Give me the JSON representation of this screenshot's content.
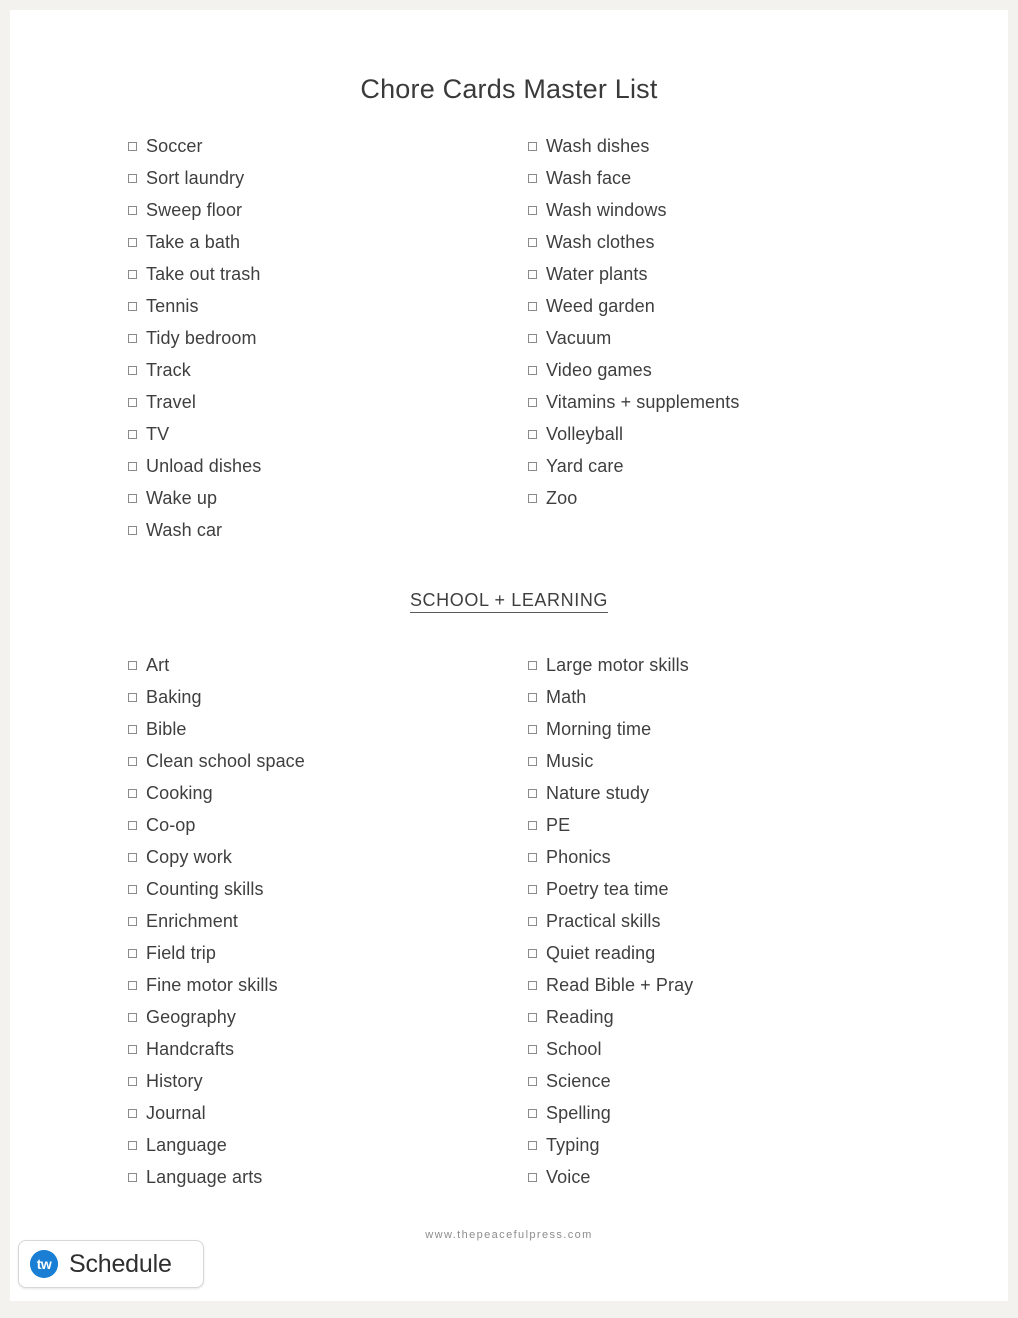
{
  "page": {
    "background_color": "#f4f2ef",
    "paper_color": "#ffffff",
    "title": "Chore Cards Master List",
    "footer_url": "www.thepeacefulpress.com"
  },
  "sections": [
    {
      "heading": "",
      "left_column": [
        "Soccer",
        "Sort laundry",
        "Sweep floor",
        "Take a bath",
        "Take out trash",
        "Tennis",
        "Tidy bedroom",
        "Track",
        "Travel",
        "TV",
        "Unload dishes",
        "Wake up",
        "Wash car"
      ],
      "right_column": [
        "Wash dishes",
        "Wash face",
        "Wash windows",
        "Wash clothes",
        "Water plants",
        "Weed garden",
        "Vacuum",
        "Video games",
        "Vitamins + supplements",
        "Volleyball",
        "Yard care",
        "Zoo"
      ]
    },
    {
      "heading": "SCHOOL + LEARNING",
      "left_column": [
        "Art",
        "Baking",
        "Bible",
        "Clean school space",
        "Cooking",
        "Co-op",
        "Copy work",
        "Counting skills",
        "Enrichment",
        "Field trip",
        "Fine motor skills",
        "Geography",
        "Handcrafts",
        "History",
        "Journal",
        "Language",
        "Language arts"
      ],
      "right_column": [
        "Large motor skills",
        "Math",
        "Morning time",
        "Music",
        "Nature study",
        "PE",
        "Phonics",
        "Poetry tea time",
        "Practical skills",
        "Quiet reading",
        "Read Bible + Pray",
        "Reading",
        "School",
        "Science",
        "Spelling",
        "Typing",
        "Voice"
      ]
    }
  ],
  "schedule_widget": {
    "label": "Schedule",
    "logo_text": "tw",
    "logo_color": "#1a7fd4",
    "icon_name": "tw-logo-icon"
  },
  "icons": {
    "checkbox": "checkbox-icon"
  }
}
